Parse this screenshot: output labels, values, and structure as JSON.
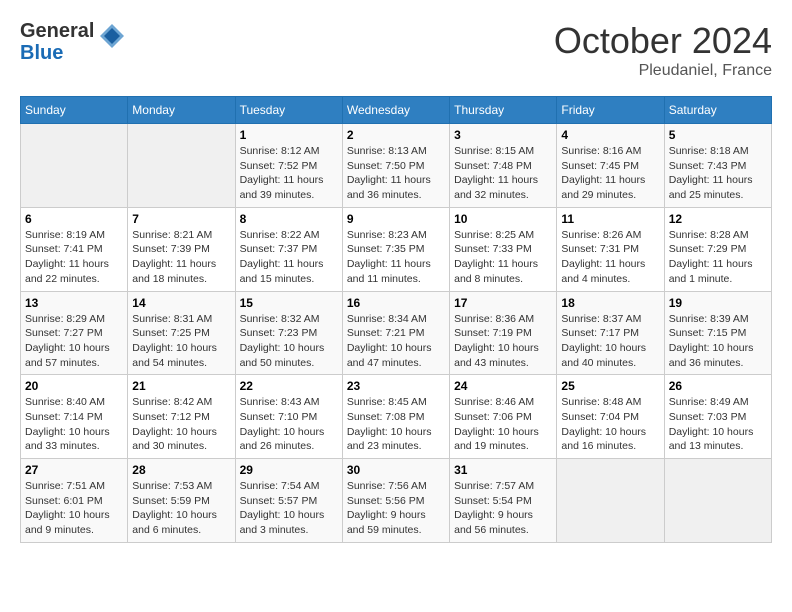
{
  "logo": {
    "general": "General",
    "blue": "Blue"
  },
  "header": {
    "month": "October 2024",
    "location": "Pleudaniel, France"
  },
  "weekdays": [
    "Sunday",
    "Monday",
    "Tuesday",
    "Wednesday",
    "Thursday",
    "Friday",
    "Saturday"
  ],
  "weeks": [
    [
      {
        "day": "",
        "info": ""
      },
      {
        "day": "",
        "info": ""
      },
      {
        "day": "1",
        "info": "Sunrise: 8:12 AM\nSunset: 7:52 PM\nDaylight: 11 hours and 39 minutes."
      },
      {
        "day": "2",
        "info": "Sunrise: 8:13 AM\nSunset: 7:50 PM\nDaylight: 11 hours and 36 minutes."
      },
      {
        "day": "3",
        "info": "Sunrise: 8:15 AM\nSunset: 7:48 PM\nDaylight: 11 hours and 32 minutes."
      },
      {
        "day": "4",
        "info": "Sunrise: 8:16 AM\nSunset: 7:45 PM\nDaylight: 11 hours and 29 minutes."
      },
      {
        "day": "5",
        "info": "Sunrise: 8:18 AM\nSunset: 7:43 PM\nDaylight: 11 hours and 25 minutes."
      }
    ],
    [
      {
        "day": "6",
        "info": "Sunrise: 8:19 AM\nSunset: 7:41 PM\nDaylight: 11 hours and 22 minutes."
      },
      {
        "day": "7",
        "info": "Sunrise: 8:21 AM\nSunset: 7:39 PM\nDaylight: 11 hours and 18 minutes."
      },
      {
        "day": "8",
        "info": "Sunrise: 8:22 AM\nSunset: 7:37 PM\nDaylight: 11 hours and 15 minutes."
      },
      {
        "day": "9",
        "info": "Sunrise: 8:23 AM\nSunset: 7:35 PM\nDaylight: 11 hours and 11 minutes."
      },
      {
        "day": "10",
        "info": "Sunrise: 8:25 AM\nSunset: 7:33 PM\nDaylight: 11 hours and 8 minutes."
      },
      {
        "day": "11",
        "info": "Sunrise: 8:26 AM\nSunset: 7:31 PM\nDaylight: 11 hours and 4 minutes."
      },
      {
        "day": "12",
        "info": "Sunrise: 8:28 AM\nSunset: 7:29 PM\nDaylight: 11 hours and 1 minute."
      }
    ],
    [
      {
        "day": "13",
        "info": "Sunrise: 8:29 AM\nSunset: 7:27 PM\nDaylight: 10 hours and 57 minutes."
      },
      {
        "day": "14",
        "info": "Sunrise: 8:31 AM\nSunset: 7:25 PM\nDaylight: 10 hours and 54 minutes."
      },
      {
        "day": "15",
        "info": "Sunrise: 8:32 AM\nSunset: 7:23 PM\nDaylight: 10 hours and 50 minutes."
      },
      {
        "day": "16",
        "info": "Sunrise: 8:34 AM\nSunset: 7:21 PM\nDaylight: 10 hours and 47 minutes."
      },
      {
        "day": "17",
        "info": "Sunrise: 8:36 AM\nSunset: 7:19 PM\nDaylight: 10 hours and 43 minutes."
      },
      {
        "day": "18",
        "info": "Sunrise: 8:37 AM\nSunset: 7:17 PM\nDaylight: 10 hours and 40 minutes."
      },
      {
        "day": "19",
        "info": "Sunrise: 8:39 AM\nSunset: 7:15 PM\nDaylight: 10 hours and 36 minutes."
      }
    ],
    [
      {
        "day": "20",
        "info": "Sunrise: 8:40 AM\nSunset: 7:14 PM\nDaylight: 10 hours and 33 minutes."
      },
      {
        "day": "21",
        "info": "Sunrise: 8:42 AM\nSunset: 7:12 PM\nDaylight: 10 hours and 30 minutes."
      },
      {
        "day": "22",
        "info": "Sunrise: 8:43 AM\nSunset: 7:10 PM\nDaylight: 10 hours and 26 minutes."
      },
      {
        "day": "23",
        "info": "Sunrise: 8:45 AM\nSunset: 7:08 PM\nDaylight: 10 hours and 23 minutes."
      },
      {
        "day": "24",
        "info": "Sunrise: 8:46 AM\nSunset: 7:06 PM\nDaylight: 10 hours and 19 minutes."
      },
      {
        "day": "25",
        "info": "Sunrise: 8:48 AM\nSunset: 7:04 PM\nDaylight: 10 hours and 16 minutes."
      },
      {
        "day": "26",
        "info": "Sunrise: 8:49 AM\nSunset: 7:03 PM\nDaylight: 10 hours and 13 minutes."
      }
    ],
    [
      {
        "day": "27",
        "info": "Sunrise: 7:51 AM\nSunset: 6:01 PM\nDaylight: 10 hours and 9 minutes."
      },
      {
        "day": "28",
        "info": "Sunrise: 7:53 AM\nSunset: 5:59 PM\nDaylight: 10 hours and 6 minutes."
      },
      {
        "day": "29",
        "info": "Sunrise: 7:54 AM\nSunset: 5:57 PM\nDaylight: 10 hours and 3 minutes."
      },
      {
        "day": "30",
        "info": "Sunrise: 7:56 AM\nSunset: 5:56 PM\nDaylight: 9 hours and 59 minutes."
      },
      {
        "day": "31",
        "info": "Sunrise: 7:57 AM\nSunset: 5:54 PM\nDaylight: 9 hours and 56 minutes."
      },
      {
        "day": "",
        "info": ""
      },
      {
        "day": "",
        "info": ""
      }
    ]
  ]
}
